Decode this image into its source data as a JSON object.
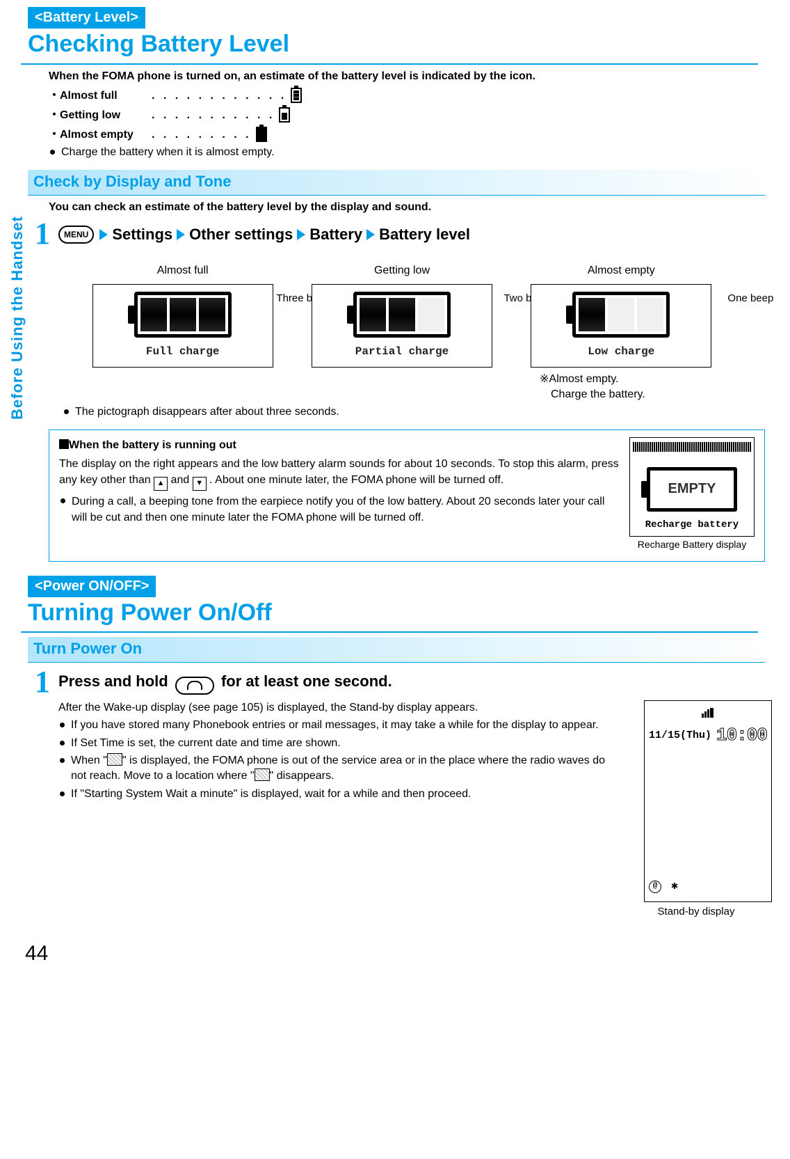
{
  "sideLabel": "Before Using the Handset",
  "sec1": {
    "tag": "<Battery Level>",
    "title": "Checking Battery Level",
    "intro": "When the FOMA phone is turned on, an estimate of the battery level is indicated by the icon.",
    "rows": {
      "full": "・Almost full",
      "low": "・Getting low",
      "empty": "・Almost empty"
    },
    "chargeNote": "Charge the battery when it is almost empty.",
    "subHead": "Check by Display and Tone",
    "subIntro": "You can check an estimate of the battery level by the display and sound.",
    "nav": {
      "menu": "MENU",
      "s1": "Settings",
      "s2": "Other settings",
      "s3": "Battery",
      "s4": "Battery level"
    },
    "cols": {
      "c1": {
        "label": "Almost full",
        "beep": "Three beeps",
        "cap": "Full charge"
      },
      "c2": {
        "label": "Getting low",
        "beep": "Two beeps",
        "cap": "Partial charge"
      },
      "c3": {
        "label": "Almost empty",
        "beep": "One beep",
        "cap": "Low charge"
      }
    },
    "belowNote1": "※Almost empty.",
    "belowNote2": "Charge the battery.",
    "disappear": "The pictograph disappears after about three seconds.",
    "box": {
      "head": "When the battery is running out",
      "p1a": "The display on the right appears and the low battery alarm sounds for about 10 seconds. To stop this alarm, press any key other than ",
      "p1b": " and ",
      "p1c": ". About one minute later, the FOMA phone will be turned off.",
      "p2": "During a call, a beeping tone from the earpiece notify you of the low battery. About 20 seconds later your call will be cut and then one minute later the FOMA phone will be turned off.",
      "empty": "EMPTY",
      "cap": "Recharge battery",
      "sub": "Recharge Battery display"
    }
  },
  "sec2": {
    "tag": "<Power ON/OFF>",
    "title": "Turning Power On/Off",
    "sub": "Turn Power On",
    "step": {
      "a": "Press and hold ",
      "b": " for at least one second."
    },
    "after": "After the Wake-up display (see page 105) is displayed, the Stand-by display appears.",
    "b1": "If you have stored many Phonebook entries or mail messages, it may take a while for the display to appear.",
    "b2": "If Set Time is set, the current date and time are shown.",
    "b3a": "When \"",
    "b3b": "\" is displayed, the FOMA phone is out of the service area or in the place where the radio waves do not reach. Move to a location where \"",
    "b3c": "\" disappears.",
    "b4": "If \"Starting System Wait a minute\" is displayed, wait for a while and then proceed.",
    "screenDate": "11/15(Thu)",
    "screenTime": "10:00",
    "screenCap": "Stand-by display"
  },
  "pageNum": "44"
}
